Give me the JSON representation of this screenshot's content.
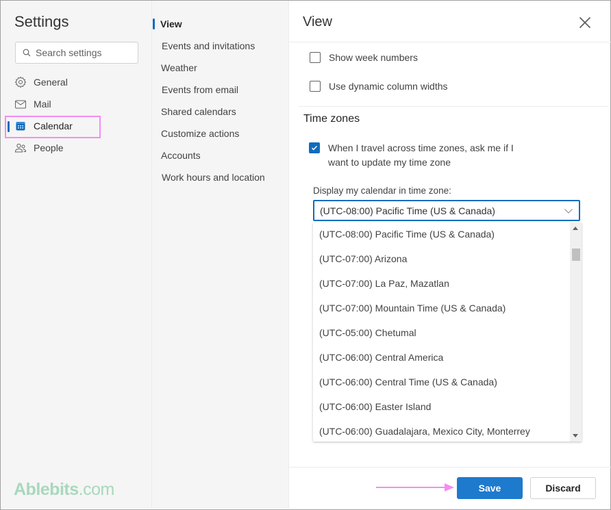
{
  "settings": {
    "title": "Settings",
    "search_placeholder": "Search settings"
  },
  "nav": {
    "items": [
      {
        "label": "General",
        "icon": "gear-icon"
      },
      {
        "label": "Mail",
        "icon": "mail-icon"
      },
      {
        "label": "Calendar",
        "icon": "calendar-icon",
        "selected": true
      },
      {
        "label": "People",
        "icon": "people-icon"
      }
    ]
  },
  "subnav": {
    "items": [
      {
        "label": "View",
        "active": true
      },
      {
        "label": "Events and invitations"
      },
      {
        "label": "Weather"
      },
      {
        "label": "Events from email"
      },
      {
        "label": "Shared calendars"
      },
      {
        "label": "Customize actions"
      },
      {
        "label": "Accounts"
      },
      {
        "label": "Work hours and location"
      }
    ]
  },
  "pane": {
    "title": "View",
    "close_icon": "close-icon",
    "options": [
      {
        "label": "Show week numbers",
        "checked": false
      },
      {
        "label": "Use dynamic column widths",
        "checked": false
      }
    ],
    "time_zones": {
      "title": "Time zones",
      "travel_option": {
        "line1": "When I travel across time zones, ask me if I",
        "line2": "want to update my time zone",
        "checked": true
      },
      "display_label": "Display my calendar in time zone:",
      "selected": "(UTC-08:00) Pacific Time (US & Canada)",
      "options": [
        "(UTC-08:00) Pacific Time (US & Canada)",
        "(UTC-07:00) Arizona",
        "(UTC-07:00) La Paz, Mazatlan",
        "(UTC-07:00) Mountain Time (US & Canada)",
        "(UTC-05:00) Chetumal",
        "(UTC-06:00) Central America",
        "(UTC-06:00) Central Time (US & Canada)",
        "(UTC-06:00) Easter Island",
        "(UTC-06:00) Guadalajara, Mexico City, Monterrey"
      ]
    }
  },
  "footer": {
    "save_label": "Save",
    "discard_label": "Discard"
  },
  "watermark": {
    "bold": "Ablebits",
    "rest": ".com"
  },
  "colors": {
    "accent": "#0f6cbd",
    "save_button": "#1e7acd",
    "annotation": "#f48cf4",
    "watermark": "#a8d8bd"
  }
}
